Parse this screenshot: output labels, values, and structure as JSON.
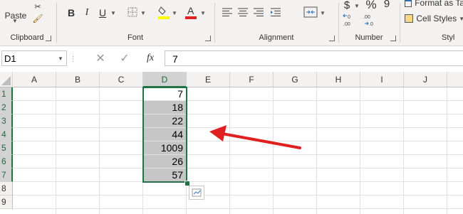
{
  "ribbon": {
    "clipboard": {
      "paste_label": "Paste",
      "group_label": "Clipboard"
    },
    "font": {
      "group_label": "Font",
      "bold": "B",
      "italic": "I",
      "underline": "U"
    },
    "alignment": {
      "group_label": "Alignment"
    },
    "number": {
      "group_label": "Number",
      "currency": "$",
      "percent": "%",
      "comma": "9"
    },
    "styles": {
      "format_as_table": "Format as Ta",
      "cell_styles": "Cell Styles",
      "group_label": "Styl"
    }
  },
  "formula_bar": {
    "name_box": "D1",
    "fx": "fx",
    "value": "7"
  },
  "grid": {
    "columns": [
      "A",
      "B",
      "C",
      "D",
      "E",
      "F",
      "G",
      "H",
      "I",
      "J"
    ],
    "rows": [
      "1",
      "2",
      "3",
      "4",
      "5",
      "6",
      "7",
      "8",
      "9"
    ],
    "column_d_values": [
      "7",
      "18",
      "22",
      "44",
      "1009",
      "26",
      "57"
    ]
  },
  "colors": {
    "accent": "#217346",
    "arrow": "#e02020"
  }
}
